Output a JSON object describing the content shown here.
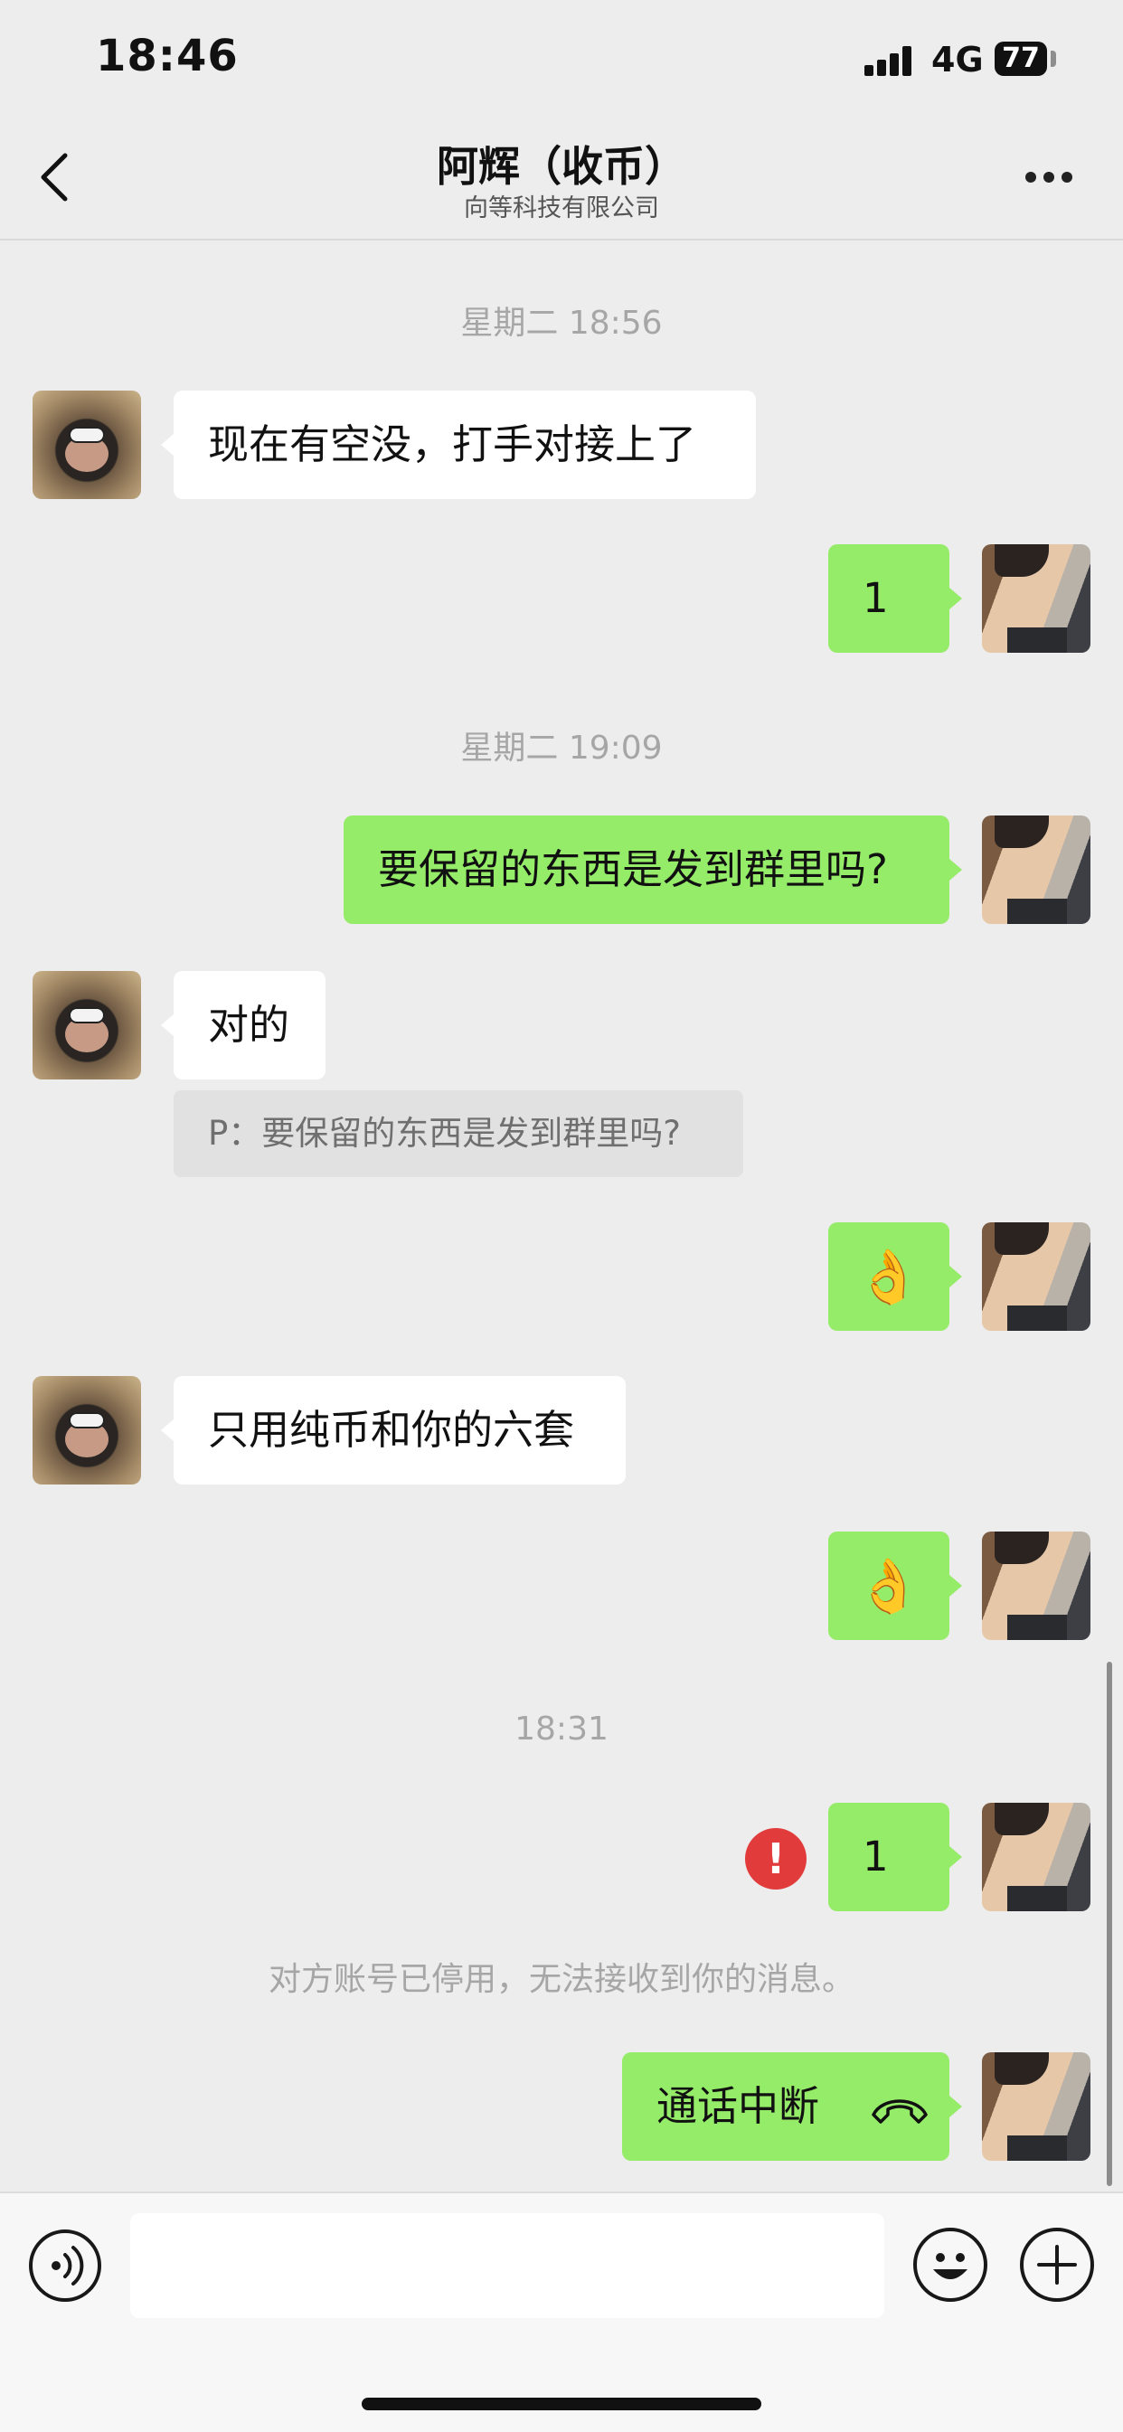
{
  "status_bar": {
    "time": "18:46",
    "network": "4G",
    "battery": "77"
  },
  "header": {
    "title": "阿辉（收币）",
    "subtitle": "向等科技有限公司",
    "back_icon": "chevron-left-icon",
    "more_icon": "ellipsis-icon"
  },
  "timestamps": [
    "星期二 18:56",
    "星期二 19:09",
    "18:31"
  ],
  "messages": {
    "m1": "现在有空没，打手对接上了",
    "m2": "1",
    "m3": "要保留的东西是发到群里吗?",
    "m4": "对的",
    "m4_quote": "P：要保留的东西是发到群里吗?",
    "m5": "👌",
    "m6": "只用纯币和你的六套",
    "m7": "👌",
    "m8": "1",
    "m9": "通话中断"
  },
  "error_icon": "!",
  "system_note": "对方账号已停用，无法接收到你的消息。",
  "input": {
    "value": "",
    "placeholder": ""
  },
  "bottom_icons": [
    "voice-icon",
    "emoji-icon",
    "plus-icon"
  ],
  "colors": {
    "sent_bubble": "#95ec69",
    "received_bubble": "#ffffff",
    "background": "#ededed",
    "error": "#e23b3b"
  }
}
